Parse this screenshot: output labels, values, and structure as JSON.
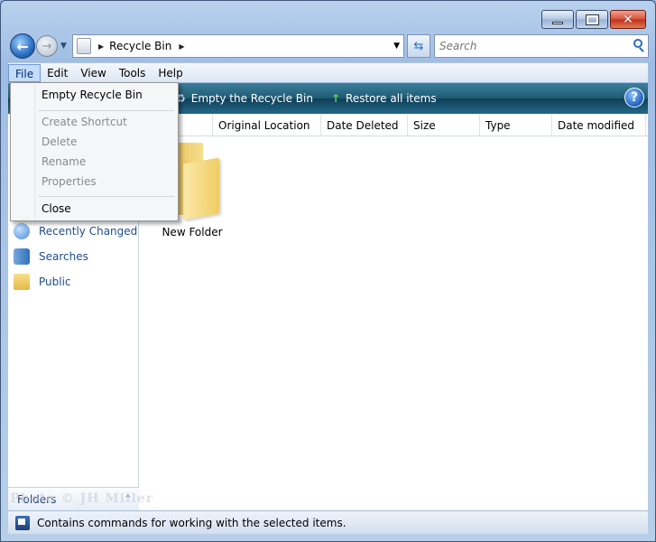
{
  "window": {
    "caption": {
      "minimize": "—",
      "maximize": "",
      "close": "✕"
    }
  },
  "nav": {
    "back_glyph": "←",
    "forward_glyph": "→",
    "address_crumb": "Recycle Bin",
    "refresh_glyph": "⇆",
    "search_placeholder": "Search"
  },
  "menubar": {
    "items": [
      "File",
      "Edit",
      "View",
      "Tools",
      "Help"
    ]
  },
  "toolbar": {
    "empty_label": "Empty the Recycle Bin",
    "restore_label": "Restore all items",
    "help_glyph": "?"
  },
  "navpane": {
    "items": [
      "Recently Changed",
      "Searches",
      "Public"
    ],
    "folders_label": "Folders",
    "folders_chevron": "⌃"
  },
  "columns": [
    "Original Location",
    "Date Deleted",
    "Size",
    "Type",
    "Date modified"
  ],
  "files": [
    {
      "name": "New Folder"
    }
  ],
  "file_menu": {
    "items": [
      {
        "label": "Empty Recycle Bin",
        "enabled": true
      },
      {
        "label": "Create Shortcut",
        "enabled": false
      },
      {
        "label": "Delete",
        "enabled": false
      },
      {
        "label": "Rename",
        "enabled": false
      },
      {
        "label": "Properties",
        "enabled": false
      },
      {
        "label": "Close",
        "enabled": true
      }
    ]
  },
  "status": {
    "text": "Contains commands for working with the selected items."
  },
  "watermark": "Photo © JH Miller",
  "colors": {
    "toolbar": "#1e5a74",
    "link": "#1f4e8c",
    "menu_highlight": "#c4dcf7"
  }
}
